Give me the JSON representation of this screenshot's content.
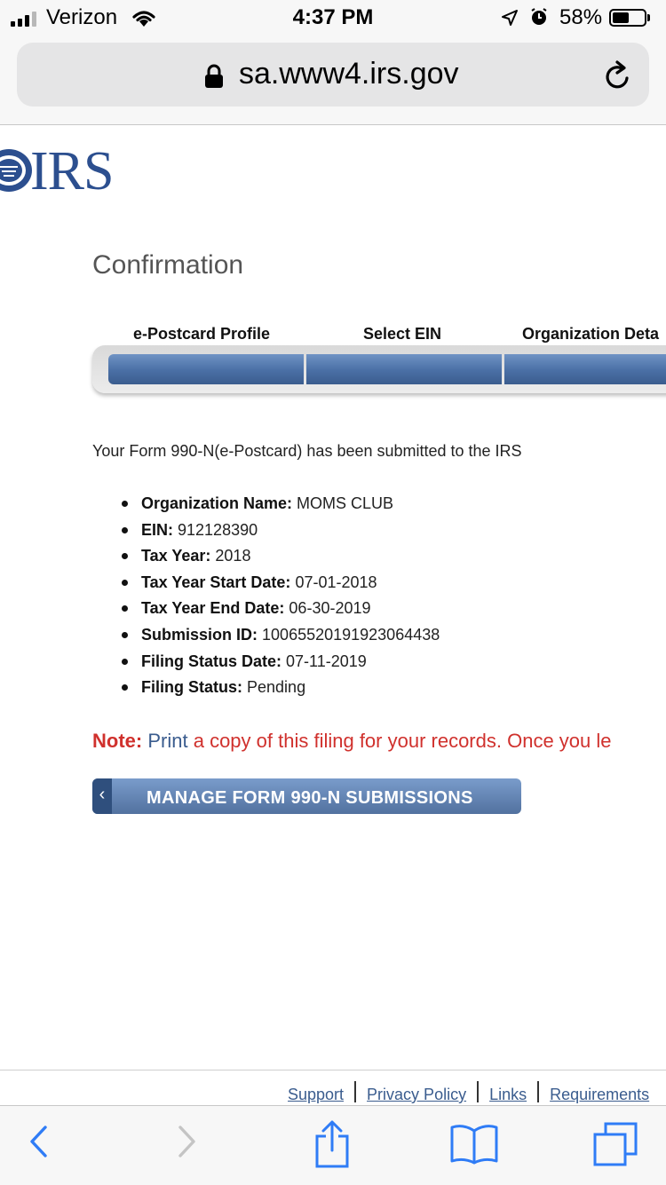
{
  "status_bar": {
    "carrier": "Verizon",
    "time": "4:37 PM",
    "battery_percent": "58%",
    "battery_level": 0.58
  },
  "browser": {
    "url": "sa.www4.irs.gov"
  },
  "header": {
    "logo_text": "IRS"
  },
  "page": {
    "title": "Confirmation",
    "steps": [
      "e-Postcard Profile",
      "Select EIN",
      "Organization Deta"
    ],
    "submitted_message": "Your Form 990-N(e-Postcard) has been submitted to the IRS",
    "details": [
      {
        "label": "Organization Name:",
        "value": "MOMS CLUB"
      },
      {
        "label": "EIN:",
        "value": "912128390"
      },
      {
        "label": "Tax Year:",
        "value": "2018"
      },
      {
        "label": "Tax Year Start Date:",
        "value": "07-01-2018"
      },
      {
        "label": "Tax Year End Date:",
        "value": "06-30-2019"
      },
      {
        "label": "Submission ID:",
        "value": "10065520191923064438"
      },
      {
        "label": "Filing Status Date:",
        "value": "07-11-2019"
      },
      {
        "label": "Filing Status:",
        "value": "Pending"
      }
    ],
    "note_label": "Note:",
    "note_print_link": "Print",
    "note_text": "a copy of this filing for your records. Once you le",
    "manage_button_label": "MANAGE FORM 990-N SUBMISSIONS"
  },
  "footer": {
    "links": [
      "Support",
      "Privacy Policy",
      "Links",
      "Requirements"
    ]
  },
  "colors": {
    "irs_blue": "#2c4f8f",
    "note_red": "#d0312d",
    "link_blue": "#3a5c8e",
    "ios_blue": "#2f7cf6"
  }
}
